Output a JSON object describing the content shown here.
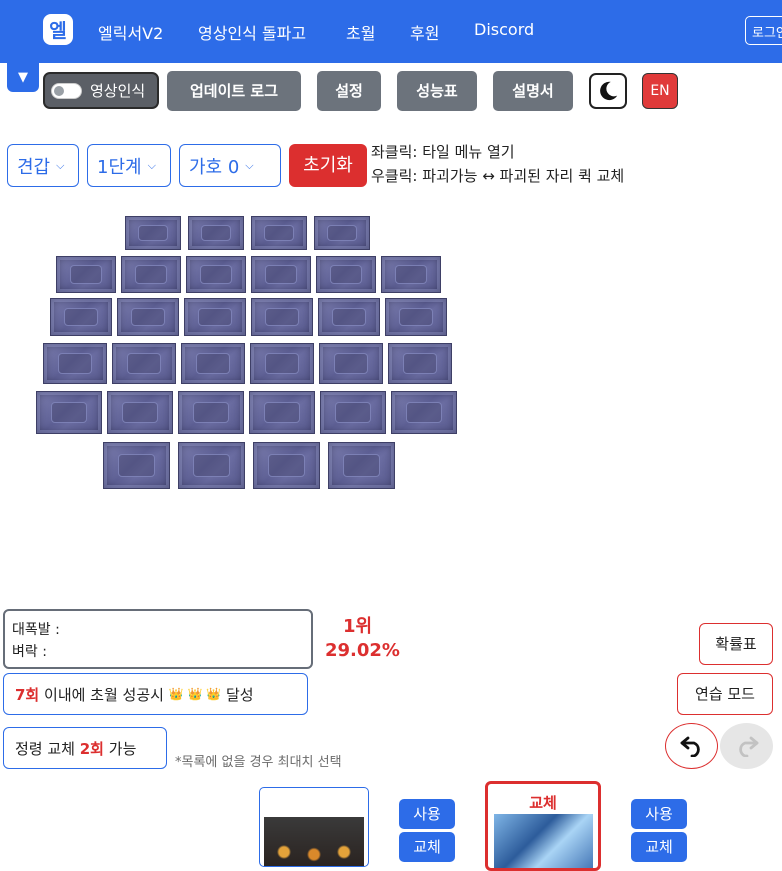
{
  "nav": {
    "logo": "엘",
    "links": [
      "엘릭서V2",
      "영상인식 돌파고",
      "초월",
      "후원",
      "Discord"
    ],
    "login": "로그인"
  },
  "toolbar": {
    "dropdown_icon": "▼",
    "vision_toggle_label": "영상인식",
    "update_log": "업데이트 로그",
    "settings": "설정",
    "performance": "성능표",
    "manual": "설명서",
    "dark_mode_icon": "moon-icon",
    "lang": "EN"
  },
  "controls": {
    "part_select": "견갑",
    "stage_select": "1단계",
    "protection_select": "가호 0",
    "reset": "초기화",
    "hint_left": "좌클릭: 타일 메뉴 열기",
    "hint_right": "우클릭: 파괴가능 ↔ 파괴된 자리 퀵 교체"
  },
  "board": {
    "rows": [
      4,
      6,
      6,
      6,
      6,
      4
    ],
    "tile_state": "breakable"
  },
  "results": {
    "line1_label": "대폭발 :",
    "line2_label": "벼락 :",
    "rank": "1위",
    "probability": "29.02%",
    "goal_count": "7회",
    "goal_text": " 이내에 초월 성공시 ",
    "goal_crowns": "👑 👑 👑",
    "goal_suffix": " 달성",
    "spirit_prefix": "정령 교체 ",
    "spirit_count": "2회",
    "spirit_suffix": " 가능",
    "note": "*목록에 없을 경우 최대치 선택",
    "prob_table": "확률표",
    "practice_mode": "연습 모드"
  },
  "cards": {
    "use_label": "사용",
    "swap_label": "교체",
    "selected_card_label": "교체"
  }
}
